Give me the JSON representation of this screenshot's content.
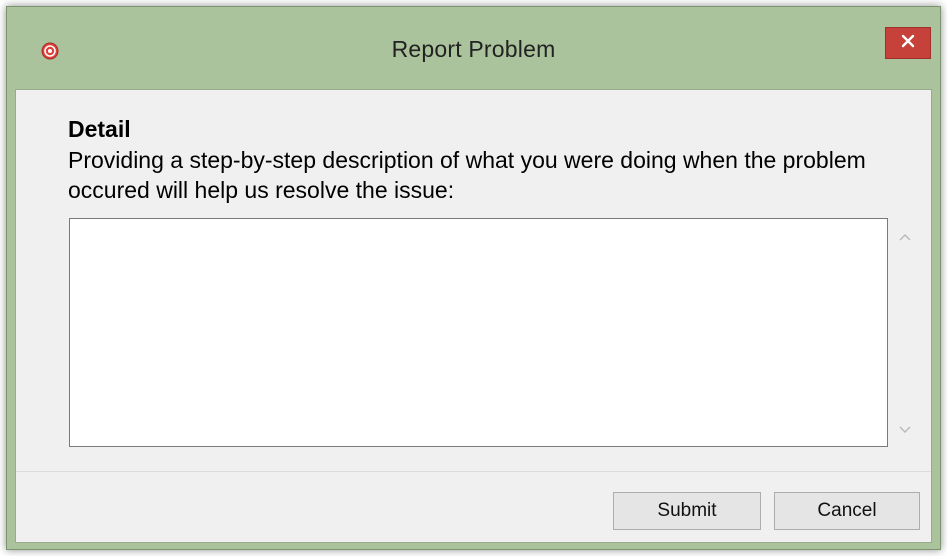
{
  "window": {
    "title": "Report Problem",
    "close_glyph": "✕",
    "app_icon": "app-logo-icon",
    "accent_color": "#abc39c",
    "close_color": "#c7413b"
  },
  "content": {
    "heading": "Detail",
    "description": "Providing a step-by-step description of what you were doing when the problem occured will help us resolve the issue:",
    "textarea_value": "",
    "textarea_placeholder": ""
  },
  "scrollbar": {
    "up_icon": "chevron-up-icon",
    "down_icon": "chevron-down-icon"
  },
  "buttons": {
    "submit_label": "Submit",
    "cancel_label": "Cancel"
  }
}
